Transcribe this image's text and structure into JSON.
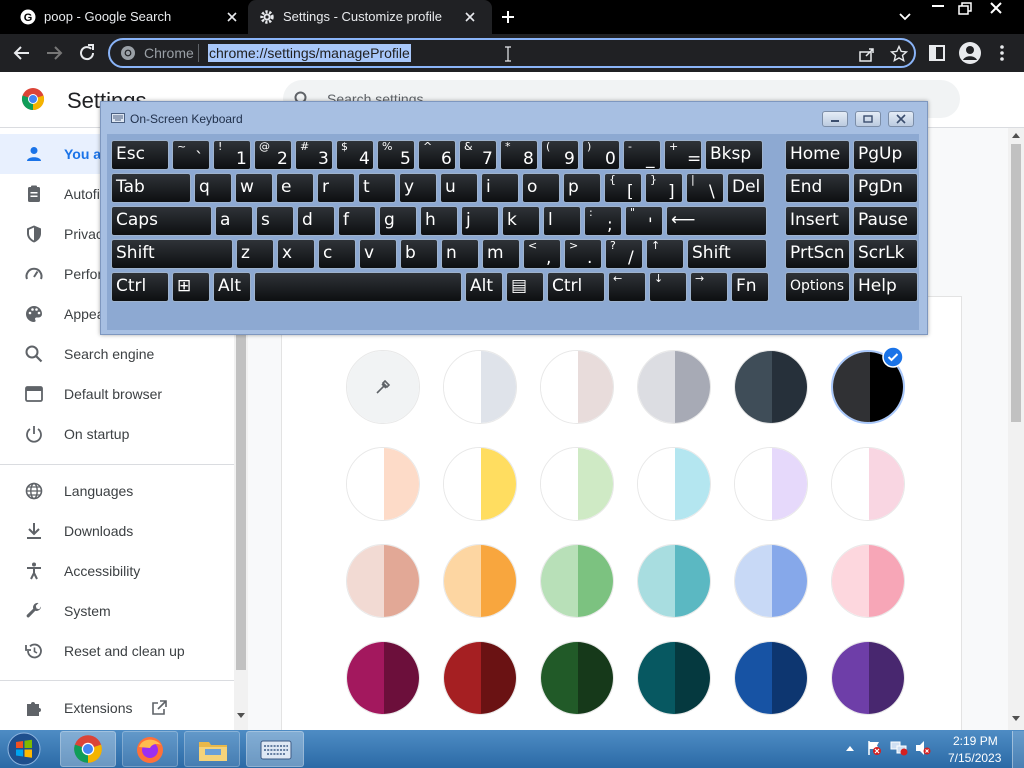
{
  "tabs": [
    {
      "title": "poop - Google Search"
    },
    {
      "title": "Settings - Customize profile"
    }
  ],
  "omnibox": {
    "chip": "Chrome",
    "url": "chrome://settings/manageProfile"
  },
  "settings": {
    "title": "Settings",
    "search_placeholder": "Search settings",
    "nav": [
      {
        "label": "You and Google",
        "icon": "person-icon"
      },
      {
        "label": "Autofill",
        "icon": "clipboard-icon"
      },
      {
        "label": "Privacy and security",
        "icon": "shield-icon"
      },
      {
        "label": "Performance",
        "icon": "speedometer-icon"
      },
      {
        "label": "Appearance",
        "icon": "palette-icon"
      },
      {
        "label": "Search engine",
        "icon": "search-icon"
      },
      {
        "label": "Default browser",
        "icon": "browser-icon"
      },
      {
        "label": "On startup",
        "icon": "power-icon"
      },
      {
        "label": "Languages",
        "icon": "globe-icon"
      },
      {
        "label": "Downloads",
        "icon": "download-icon"
      },
      {
        "label": "Accessibility",
        "icon": "accessibility-icon"
      },
      {
        "label": "System",
        "icon": "wrench-icon"
      },
      {
        "label": "Reset and clean up",
        "icon": "restore-icon"
      },
      {
        "label": "Extensions",
        "icon": "puzzle-icon"
      }
    ]
  },
  "themes": [
    [
      {
        "left": "#f1f3f4",
        "right": "#f1f3f4",
        "kind": "custom"
      },
      {
        "left": "#ffffff",
        "right": "#dfe3ea"
      },
      {
        "left": "#ffffff",
        "right": "#e8dcdb"
      },
      {
        "left": "#dcdde2",
        "right": "#a7aab5"
      },
      {
        "left": "#3f4d58",
        "right": "#26303a"
      },
      {
        "left": "#303134",
        "right": "#000000",
        "selected": true
      }
    ],
    [
      {
        "left": "#ffffff",
        "right": "#fddbc8"
      },
      {
        "left": "#ffffff",
        "right": "#ffdd60"
      },
      {
        "left": "#ffffff",
        "right": "#cfeac5"
      },
      {
        "left": "#ffffff",
        "right": "#b4e6f0"
      },
      {
        "left": "#ffffff",
        "right": "#e6d9fb"
      },
      {
        "left": "#ffffff",
        "right": "#f9d6e2"
      }
    ],
    [
      {
        "left": "#f2dad3",
        "right": "#e2a896"
      },
      {
        "left": "#fdd6a2",
        "right": "#f8a63e"
      },
      {
        "left": "#b8e0b8",
        "right": "#7cc280"
      },
      {
        "left": "#a8dde0",
        "right": "#5bb8c2"
      },
      {
        "left": "#c8d9f6",
        "right": "#86a8ea"
      },
      {
        "left": "#fdd7de",
        "right": "#f7a6b7"
      }
    ],
    [
      {
        "left": "#a3185e",
        "right": "#6c0f3b"
      },
      {
        "left": "#a51f22",
        "right": "#6a1213"
      },
      {
        "left": "#215a28",
        "right": "#16391a"
      },
      {
        "left": "#075861",
        "right": "#05393f"
      },
      {
        "left": "#1753a4",
        "right": "#0d3670"
      },
      {
        "left": "#6e3ea8",
        "right": "#48276f"
      }
    ]
  ],
  "osk": {
    "title": "On-Screen Keyboard",
    "rows": [
      [
        {
          "w": 1,
          "l": "Esc"
        },
        {
          "s": "~",
          "b": "`"
        },
        {
          "s": "!",
          "b": "1"
        },
        {
          "s": "@",
          "b": "2"
        },
        {
          "s": "#",
          "b": "3"
        },
        {
          "s": "$",
          "b": "4"
        },
        {
          "s": "%",
          "b": "5"
        },
        {
          "s": "^",
          "b": "6"
        },
        {
          "s": "&",
          "b": "7"
        },
        {
          "s": "*",
          "b": "8"
        },
        {
          "s": "(",
          "b": "9"
        },
        {
          "s": ")",
          "b": "0"
        },
        {
          "s": "-",
          "b": "_"
        },
        {
          "s": "+",
          "b": "="
        },
        {
          "l": "Bksp"
        }
      ],
      [
        {
          "l": "Tab"
        },
        {
          "l": "q"
        },
        {
          "l": "w"
        },
        {
          "l": "e"
        },
        {
          "l": "r"
        },
        {
          "l": "t"
        },
        {
          "l": "y"
        },
        {
          "l": "u"
        },
        {
          "l": "i"
        },
        {
          "l": "o"
        },
        {
          "l": "p"
        },
        {
          "s": "{",
          "b": "["
        },
        {
          "s": "}",
          "b": "]"
        },
        {
          "s": "|",
          "b": "\\"
        },
        {
          "l": "Del"
        }
      ],
      [
        {
          "l": "Caps"
        },
        {
          "l": "a"
        },
        {
          "l": "s"
        },
        {
          "l": "d"
        },
        {
          "l": "f"
        },
        {
          "l": "g"
        },
        {
          "l": "h"
        },
        {
          "l": "j"
        },
        {
          "l": "k"
        },
        {
          "l": "l"
        },
        {
          "s": ":",
          "b": ";"
        },
        {
          "s": "\"",
          "b": "'"
        },
        {
          "l": "⟵"
        }
      ],
      [
        {
          "l": "Shift"
        },
        {
          "l": "z"
        },
        {
          "l": "x"
        },
        {
          "l": "c"
        },
        {
          "l": "v"
        },
        {
          "l": "b"
        },
        {
          "l": "n"
        },
        {
          "l": "m"
        },
        {
          "s": "<",
          "b": ","
        },
        {
          "s": ">",
          "b": "."
        },
        {
          "s": "?",
          "b": "/"
        },
        {
          "s": "↑",
          "b": ""
        },
        {
          "l": "Shift"
        }
      ],
      [
        {
          "l": "Ctrl"
        },
        {
          "l": "⊞"
        },
        {
          "l": "Alt"
        },
        {
          "l": ""
        },
        {
          "l": "Alt"
        },
        {
          "l": "▤"
        },
        {
          "l": "Ctrl"
        },
        {
          "s": "←",
          "b": ""
        },
        {
          "s": "↓",
          "b": ""
        },
        {
          "s": "→",
          "b": ""
        },
        {
          "l": "Fn"
        }
      ]
    ],
    "nav": [
      [
        "Home",
        "PgUp"
      ],
      [
        "End",
        "PgDn"
      ],
      [
        "Insert",
        "Pause"
      ],
      [
        "PrtScn",
        "ScrLk"
      ],
      [
        "Options",
        "Help"
      ]
    ]
  },
  "clock": {
    "time": "2:19 PM",
    "date": "7/15/2023"
  }
}
